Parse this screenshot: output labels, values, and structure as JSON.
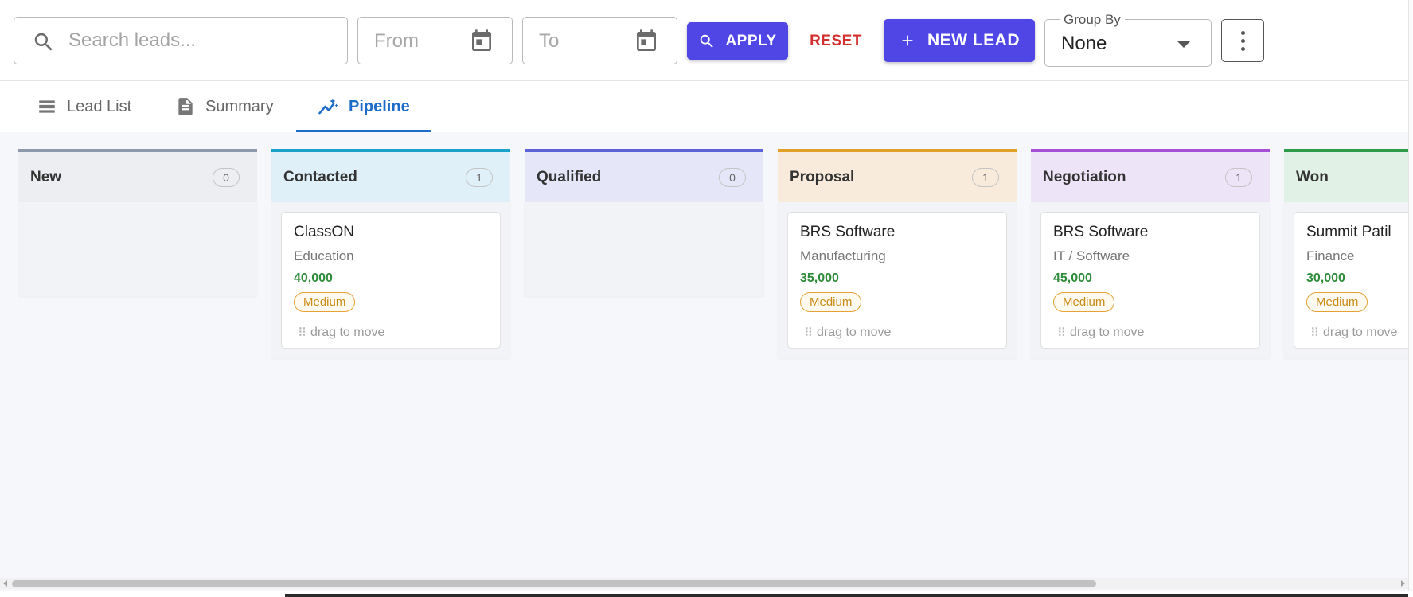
{
  "toolbar": {
    "search_placeholder": "Search leads...",
    "from_placeholder": "From",
    "to_placeholder": "To",
    "apply_label": "APPLY",
    "reset_label": "RESET",
    "new_lead_label": "NEW LEAD",
    "group_by_label": "Group By",
    "group_by_value": "None"
  },
  "tabs": [
    {
      "label": "Lead List",
      "icon": "list-icon"
    },
    {
      "label": "Summary",
      "icon": "document-icon"
    },
    {
      "label": "Pipeline",
      "icon": "trend-icon",
      "active": true
    }
  ],
  "columns": [
    {
      "title": "New",
      "count": "0",
      "color": "#8e99ab",
      "bg": "#eceef2",
      "cards": []
    },
    {
      "title": "Contacted",
      "count": "1",
      "color": "#1aa1c9",
      "bg": "#dff0f8",
      "cards": [
        {
          "company": "ClassON",
          "industry": "Education",
          "amount": "40,000",
          "priority": "Medium",
          "hint": "drag to move"
        }
      ]
    },
    {
      "title": "Qualified",
      "count": "0",
      "color": "#5c63d6",
      "bg": "#e5e7f8",
      "cards": []
    },
    {
      "title": "Proposal",
      "count": "1",
      "color": "#e0a126",
      "bg": "#f8ebdc",
      "cards": [
        {
          "company": "BRS Software",
          "industry": "Manufacturing",
          "amount": "35,000",
          "priority": "Medium",
          "hint": "drag to move"
        }
      ]
    },
    {
      "title": "Negotiation",
      "count": "1",
      "color": "#a64fd6",
      "bg": "#eee4f7",
      "cards": [
        {
          "company": "BRS Software",
          "industry": "IT / Software",
          "amount": "45,000",
          "priority": "Medium",
          "hint": "drag to move"
        }
      ]
    },
    {
      "title": "Won",
      "count": "",
      "color": "#2e9b4a",
      "bg": "#e1f1e5",
      "cards": [
        {
          "company": "Summit Patil",
          "industry": "Finance",
          "amount": "30,000",
          "priority": "Medium",
          "hint": "drag to move"
        }
      ]
    }
  ],
  "colors": {
    "primary": "#5046e5",
    "reset": "#d32f2f",
    "active_tab": "#1d6cc9",
    "amount": "#2e8b3a",
    "priority": "#e6a234"
  }
}
